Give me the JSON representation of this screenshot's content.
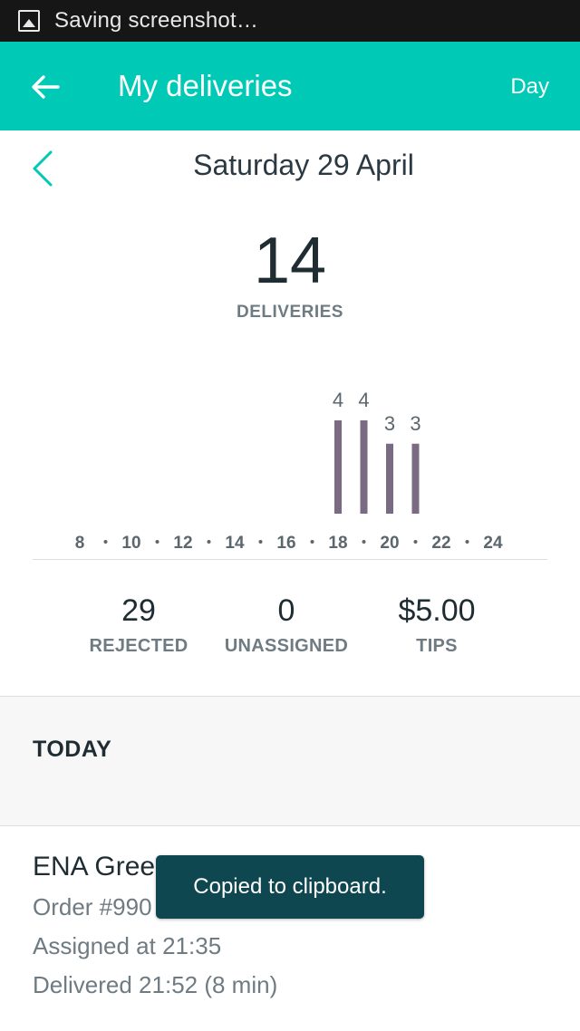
{
  "status_bar": {
    "notification_icon": "image-icon",
    "text": "Saving screenshot…"
  },
  "app_bar": {
    "back_icon": "arrow-left-icon",
    "title": "My deliveries",
    "mode_label": "Day",
    "background_color": "#00c9b5"
  },
  "date_nav": {
    "prev_icon": "chevron-left-icon",
    "date_label": "Saturday 29 April"
  },
  "summary": {
    "count": "14",
    "count_label": "DELIVERIES"
  },
  "chart_data": {
    "type": "bar",
    "x_ticks": [
      "8",
      "10",
      "12",
      "14",
      "16",
      "18",
      "20",
      "22",
      "24"
    ],
    "bars": [
      {
        "hour": 18,
        "value": 4
      },
      {
        "hour": 19,
        "value": 4
      },
      {
        "hour": 20,
        "value": 3
      },
      {
        "hour": 21,
        "value": 3
      }
    ],
    "xlim": [
      8,
      24
    ],
    "ylim": [
      0,
      4
    ],
    "bar_color": "#7a6b82"
  },
  "stats": [
    {
      "value": "29",
      "label": "REJECTED"
    },
    {
      "value": "0",
      "label": "UNASSIGNED"
    },
    {
      "value": "$5.00",
      "label": "TIPS"
    }
  ],
  "section": {
    "label": "TODAY"
  },
  "delivery": {
    "name": "ENA Gree",
    "order": "Order #990",
    "assigned": "Assigned at 21:35",
    "delivered": "Delivered 21:52 (8 min)"
  },
  "toast": {
    "text": "Copied to clipboard."
  }
}
